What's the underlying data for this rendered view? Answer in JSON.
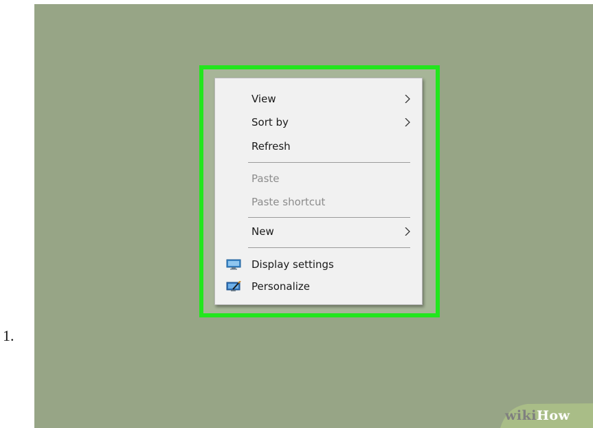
{
  "step": {
    "number": "1."
  },
  "menu": {
    "items": [
      {
        "label": "View",
        "has_submenu": true,
        "enabled": true
      },
      {
        "label": "Sort by",
        "has_submenu": true,
        "enabled": true
      },
      {
        "label": "Refresh",
        "has_submenu": false,
        "enabled": true
      },
      {
        "label": "Paste",
        "has_submenu": false,
        "enabled": false
      },
      {
        "label": "Paste shortcut",
        "has_submenu": false,
        "enabled": false
      },
      {
        "label": "New",
        "has_submenu": true,
        "enabled": true
      },
      {
        "label": "Display settings",
        "icon": "display-icon",
        "enabled": true
      },
      {
        "label": "Personalize",
        "icon": "personalize-icon",
        "enabled": true
      }
    ]
  },
  "watermark": {
    "part1": "wiki",
    "part2": "How"
  },
  "colors": {
    "desktop_background": "#97a586",
    "highlight_border": "#22e61d",
    "menu_background": "#f1f1f1",
    "disabled_text": "#8c8c8c"
  }
}
